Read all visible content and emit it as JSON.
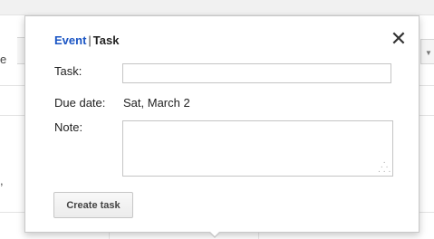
{
  "background": {
    "left_fragment_top": "e",
    "left_fragment_bottom": ","
  },
  "bubble": {
    "tabs": {
      "event_label": "Event",
      "separator": "|",
      "task_label": "Task"
    },
    "close_label": "✕",
    "task_field": {
      "label": "Task:",
      "value": ""
    },
    "due_date": {
      "label": "Due date:",
      "value": "Sat, March 2"
    },
    "note_field": {
      "label": "Note:",
      "value": ""
    },
    "create_button_label": "Create task"
  },
  "colors": {
    "event_tab": "#1a55c4",
    "text": "#222222",
    "border": "#c4c4c4"
  },
  "icons": {
    "close": "close-icon",
    "resize": "resize-grip-icon"
  }
}
